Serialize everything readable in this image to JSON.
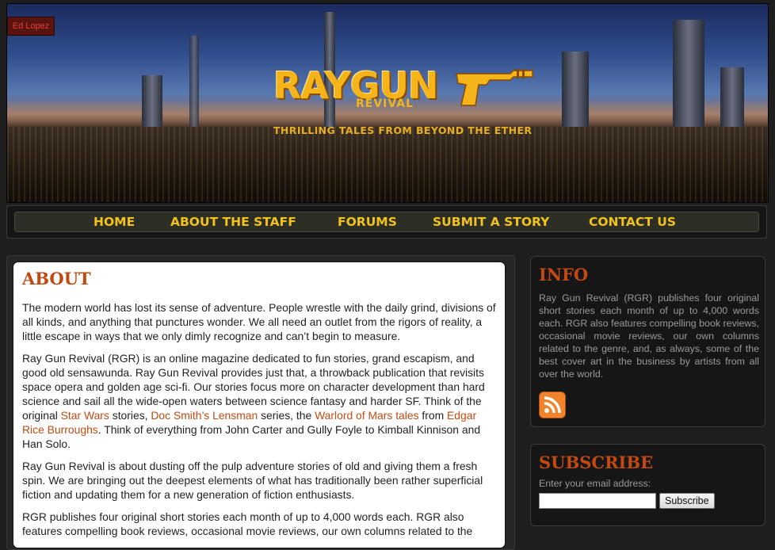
{
  "header": {
    "tag_label": "Ed Lopez",
    "logo_title": "RAYGUN",
    "logo_sub": "REVIVAL",
    "tagline": "THRILLING TALES FROM BEYOND THE ETHER"
  },
  "nav": {
    "items": [
      {
        "label": "HOME"
      },
      {
        "label": "ABOUT THE STAFF"
      },
      {
        "label": "FORUMS"
      },
      {
        "label": "SUBMIT A STORY"
      },
      {
        "label": "CONTACT US"
      }
    ],
    "color": "#f2c21c"
  },
  "main": {
    "title": "ABOUT",
    "p1": "The modern world has lost its sense of adventure. People wrestle with the daily grind, divisions of all kinds, and anything that punctures wonder. We all need an outlet from the rigors of reality, a little escape in ways that we only dimly recognize and can’t begin to measure.",
    "p2": {
      "a": "Ray Gun Revival (RGR) is an online magazine dedicated to fun stories, grand escapism, and good old sensawunda. Ray Gun Revival provides just that, a throwback publication that revisits space opera and golden age sci-fi. Our stories focus more on character development than hard science and sail all the wide-open waters between science fantasy and harder SF. Think of the original ",
      "link1": "Star Wars",
      "b": " stories, ",
      "link2": "Doc Smith’s Lensman",
      "c": " series, the ",
      "link3": "Warlord of Mars tales",
      "d": " from ",
      "link4": "Edgar Rice Burroughs",
      "e": ". Think of everything from John Carter and Gully Foyle to Kimball Kinnison and Han Solo."
    },
    "p3": "Ray Gun Revival is about dusting off the pulp adventure stories of old and giving them a fresh spin. We are bringing out the deepest elements of what has traditionally been rather superficial fiction and updating them for a new generation of fiction enthusiasts.",
    "p4": "RGR publishes four original short stories each month of up to 4,000 words each. RGR also features compelling book reviews, occasional movie reviews, our own columns related to the"
  },
  "sidebar": {
    "info": {
      "title": "INFO",
      "text": "Ray Gun Revival (RGR) publishes four original short stories each month of up to 4,000 words each. RGR also features compelling book reviews, occasional movie reviews, our own columns related to the genre, and, as always, some of the best cover art in the business by artists from all over the world.",
      "rss_icon": "rss-icon"
    },
    "subscribe": {
      "title": "SUBSCRIBE",
      "label": "Enter your email address:",
      "email_value": "",
      "button": "Subscribe"
    }
  },
  "colors": {
    "accent": "#c24a12",
    "nav_text": "#f2c21c",
    "logo": "#f5b51a"
  }
}
